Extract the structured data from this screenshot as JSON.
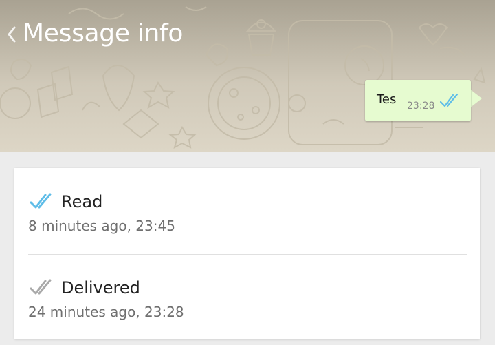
{
  "header": {
    "title": "Message info",
    "back_icon": "chevron-left-icon"
  },
  "message": {
    "text": "Tes",
    "time": "23:28",
    "status_icon": "double-check-icon",
    "status_color": "#5fbde8"
  },
  "receipts": [
    {
      "label": "Read",
      "time": "8 minutes ago, 23:45",
      "icon": "double-check-icon",
      "icon_color": "#5fbde8"
    },
    {
      "label": "Delivered",
      "time": "24 minutes ago, 23:28",
      "icon": "double-check-icon",
      "icon_color": "#a9a9a9"
    }
  ],
  "colors": {
    "bubble": "#e6fbd0",
    "wallpaper": "#d9d2c2",
    "page_background": "#ececec"
  }
}
